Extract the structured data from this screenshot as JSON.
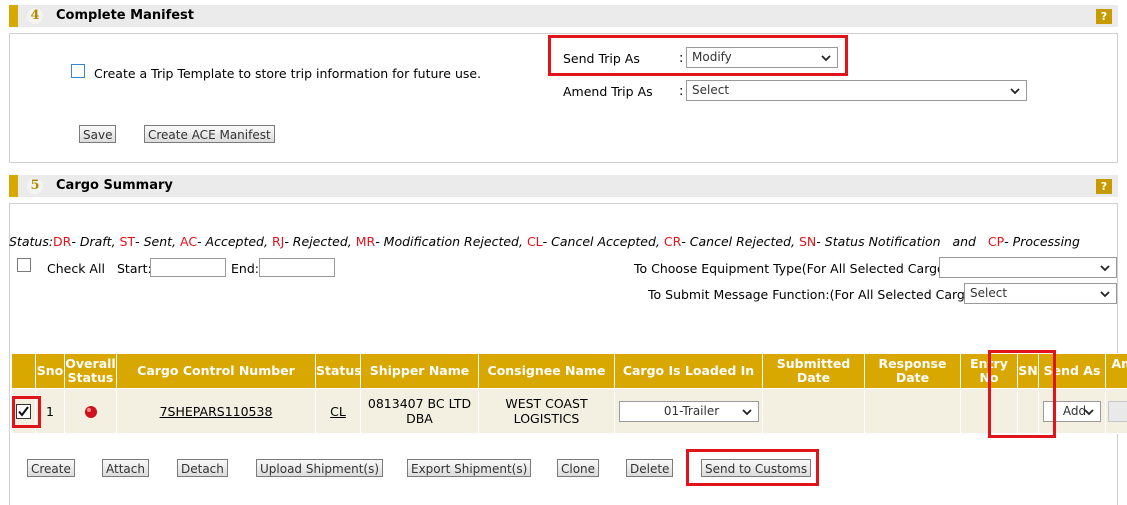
{
  "section4": {
    "number": "4",
    "title": "Complete Manifest",
    "help": "?",
    "template_checkbox_label": "Create a Trip Template to store trip information for future use.",
    "send_trip_label": "Send Trip As",
    "send_trip_colon": ":",
    "send_trip_value": "Modify",
    "amend_trip_label": "Amend Trip As",
    "amend_trip_colon": ":",
    "amend_trip_value": "Select",
    "save_button": "Save",
    "create_ace_button": "Create ACE Manifest"
  },
  "section5": {
    "number": "5",
    "title": "Cargo Summary",
    "help": "?",
    "status_prefix": "Status:",
    "status_items": [
      {
        "code": "DR",
        "text": "- Draft,"
      },
      {
        "code": "ST",
        "text": "- Sent,"
      },
      {
        "code": "AC",
        "text": "- Accepted,"
      },
      {
        "code": "RJ",
        "text": "- Rejected,"
      },
      {
        "code": "MR",
        "text": "- Modification Rejected,"
      },
      {
        "code": "CL",
        "text": "- Cancel Accepted,"
      },
      {
        "code": "CR",
        "text": "- Cancel Rejected,"
      },
      {
        "code": "SN",
        "text": "- Status Notification"
      },
      {
        "code": "CP",
        "text": "- Processing"
      }
    ],
    "status_and": "and",
    "check_all_label": "Check All",
    "start_label": "Start:",
    "end_label": "End:",
    "equipment_label": "To Choose Equipment Type(For All Selected Cargo)",
    "equipment_value": "",
    "message_label": "To Submit Message Function:(For All Selected Cargo)",
    "message_value": "Select",
    "table": {
      "headers": [
        "",
        "Sno",
        "Overall Status",
        "Cargo Control Number",
        "Status",
        "Shipper Name",
        "Consignee Name",
        "Cargo Is Loaded In",
        "Submitted Date",
        "Response Date",
        "Entry No",
        "SN",
        "Send As",
        "Amend As"
      ],
      "rows": [
        {
          "sno": "1",
          "cargo_control_number": "7SHEPARS110538",
          "status": "CL",
          "shipper": "0813407 BC LTD DBA",
          "consignee": "WEST COAST LOGISTICS",
          "loaded_in": "01-Trailer",
          "submitted_date": "",
          "response_date": "",
          "entry_no": "",
          "sn": "",
          "send_as": "Add",
          "amend_as": ""
        }
      ]
    },
    "buttons": {
      "create": "Create",
      "attach": "Attach",
      "detach": "Detach",
      "upload": "Upload Shipment(s)",
      "export": "Export Shipment(s)",
      "clone": "Clone",
      "delete": "Delete",
      "send_to_customs": "Send to Customs"
    }
  },
  "colors": {
    "gold": "#d8a800",
    "highlight_red": "#e1131b",
    "status_dot": "#d0101a",
    "row_bg": "#f3f0e2"
  }
}
